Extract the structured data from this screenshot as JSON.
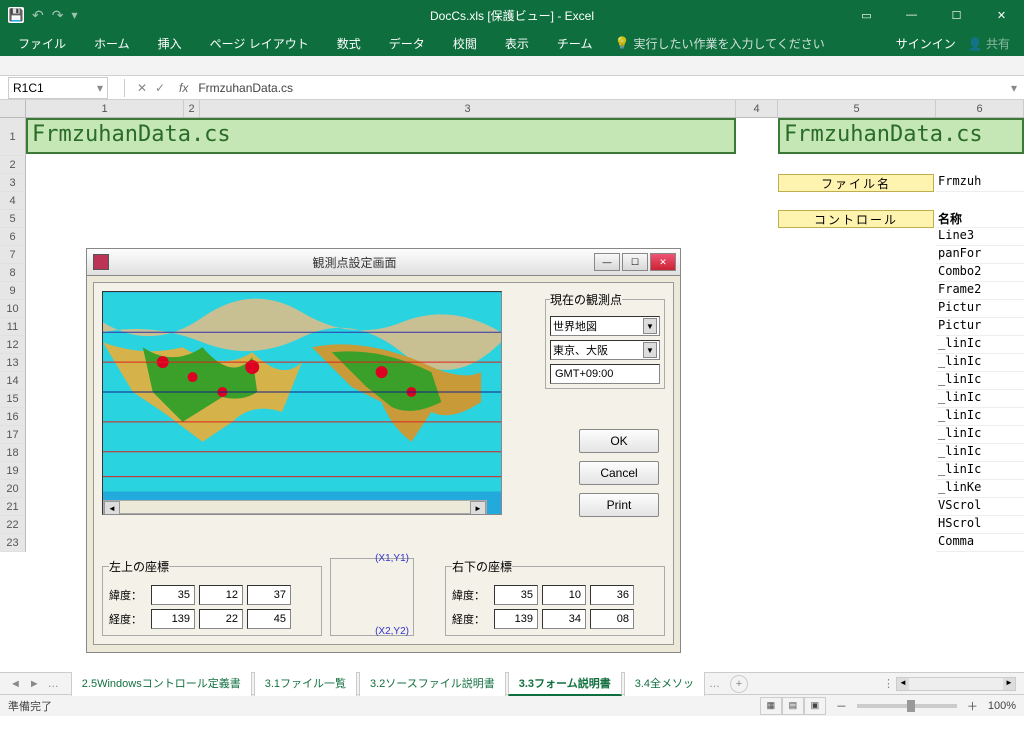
{
  "title": "DocCs.xls [保護ビュー] - Excel",
  "ribbon": {
    "tabs": [
      "ファイル",
      "ホーム",
      "挿入",
      "ページ レイアウト",
      "数式",
      "データ",
      "校閲",
      "表示",
      "チーム"
    ],
    "search_placeholder": "実行したい作業を入力してください",
    "signin": "サインイン",
    "share": "共有"
  },
  "formula": {
    "name_box": "R1C1",
    "content": "FrmzuhanData.cs"
  },
  "columns": [
    "1",
    "2",
    "3",
    "4",
    "5",
    "6"
  ],
  "rows": [
    "1",
    "2",
    "3",
    "4",
    "5",
    "6",
    "7",
    "8",
    "9",
    "10",
    "11",
    "12",
    "13",
    "14",
    "15",
    "16",
    "17",
    "18",
    "19",
    "20",
    "21",
    "22",
    "23"
  ],
  "cells": {
    "a1": "FrmzuhanData.cs",
    "e1": "FrmzuhanData.cs",
    "yellow1": "ファイル名",
    "yellow2": "コントロール",
    "c6_r3": "Frmzuh",
    "c6_r5": "名称",
    "c6_list": [
      "Line3",
      "panFor",
      "Combo2",
      "Frame2",
      "Pictur",
      "Pictur",
      "_linIc",
      "_linIc",
      "_linIc",
      "_linIc",
      "_linIc",
      "_linIc",
      "_linIc",
      "_linIc",
      "_linKe",
      "VScrol",
      "HScrol",
      "Comma"
    ]
  },
  "dialog": {
    "title": "観測点設定画面",
    "obs_legend": "現在の観測点",
    "map_combo": "世界地図",
    "loc_combo": "東京、大阪",
    "gmt": "GMT+09:00",
    "ok": "OK",
    "cancel": "Cancel",
    "print": "Print",
    "tl_legend": "左上の座標",
    "br_legend": "右下の座標",
    "lat_lbl": "緯度：",
    "lon_lbl": "経度：",
    "tl": {
      "lat": [
        "35",
        "12",
        "37"
      ],
      "lon": [
        "139",
        "22",
        "45"
      ]
    },
    "br": {
      "lat": [
        "35",
        "10",
        "36"
      ],
      "lon": [
        "139",
        "34",
        "08"
      ]
    },
    "xy1": "(X1,Y1)",
    "xy2": "(X2,Y2)"
  },
  "sheets": {
    "nav_more": "…",
    "tabs": [
      "2.5Windowsコントロール定義書",
      "3.1ファイル一覧",
      "3.2ソースファイル説明書",
      "3.3フォーム説明書",
      "3.4全メソッ"
    ],
    "trailing": "…",
    "active_index": 3
  },
  "status": {
    "ready": "準備完了",
    "zoom": "100%"
  }
}
